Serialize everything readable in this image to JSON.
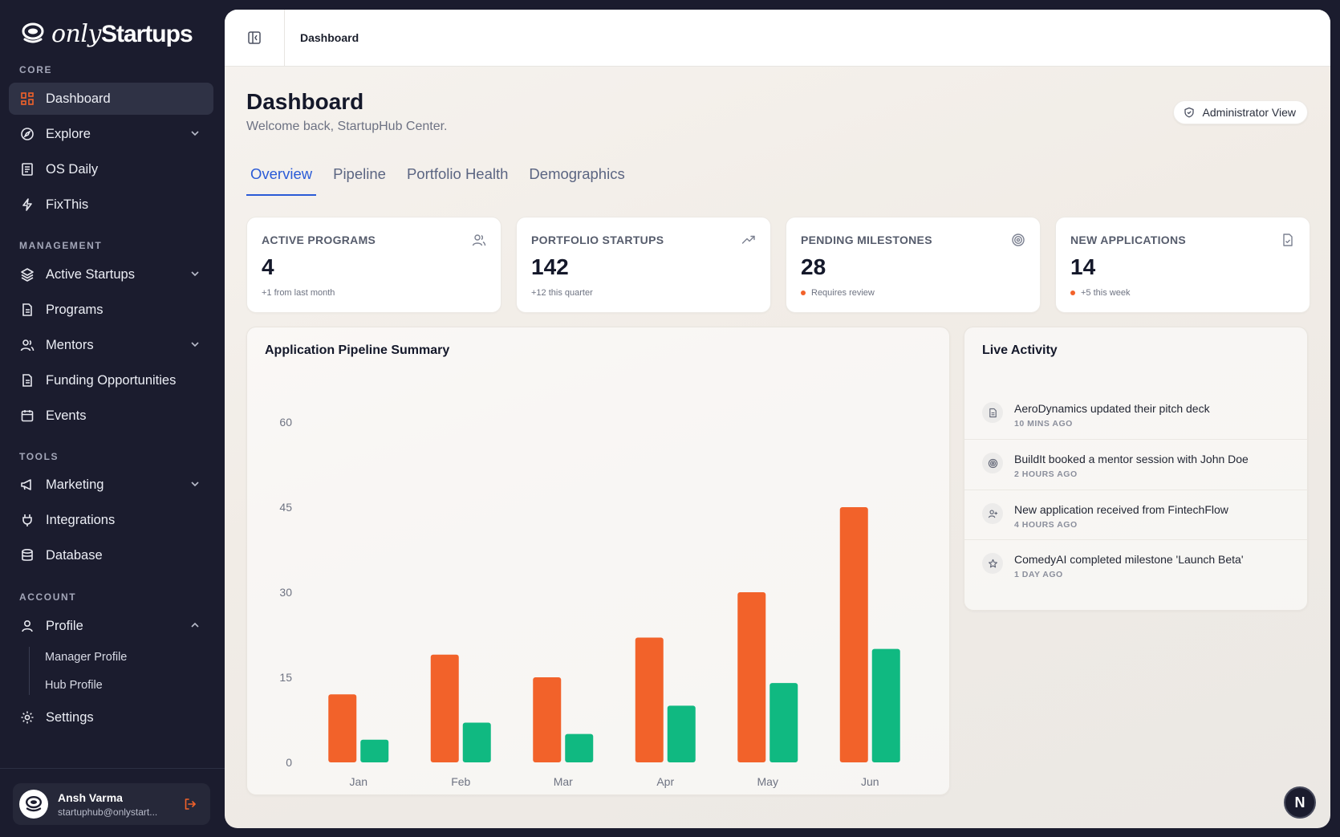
{
  "brand": {
    "name_light": "only",
    "name_bold": "Startups"
  },
  "sidebar": {
    "sections": {
      "core": "CORE",
      "management": "MANAGEMENT",
      "tools": "TOOLS",
      "account": "ACCOUNT"
    },
    "items": {
      "dashboard": "Dashboard",
      "explore": "Explore",
      "os_daily": "OS Daily",
      "fixthis": "FixThis",
      "active_startups": "Active Startups",
      "programs": "Programs",
      "mentors": "Mentors",
      "funding": "Funding Opportunities",
      "events": "Events",
      "marketing": "Marketing",
      "integrations": "Integrations",
      "database": "Database",
      "profile": "Profile",
      "manager_profile": "Manager Profile",
      "hub_profile": "Hub Profile",
      "settings": "Settings"
    },
    "user": {
      "name": "Ansh Varma",
      "email": "startuphub@onlystart..."
    }
  },
  "topbar": {
    "breadcrumb": "Dashboard"
  },
  "header": {
    "title": "Dashboard",
    "subtitle": "Welcome back, StartupHub Center.",
    "admin_button": "Administrator View"
  },
  "tabs": [
    "Overview",
    "Pipeline",
    "Portfolio Health",
    "Demographics"
  ],
  "stats": [
    {
      "label": "ACTIVE PROGRAMS",
      "value": "4",
      "note": "+1 from last month",
      "icon": "users-icon"
    },
    {
      "label": "PORTFOLIO STARTUPS",
      "value": "142",
      "note": "+12 this quarter",
      "icon": "trending-up-icon"
    },
    {
      "label": "PENDING MILESTONES",
      "value": "28",
      "note": "Requires review",
      "icon": "target-icon"
    },
    {
      "label": "NEW APPLICATIONS",
      "value": "14",
      "note": "+5 this week",
      "icon": "file-check-icon"
    }
  ],
  "pipeline_panel": {
    "title": "Application Pipeline Summary"
  },
  "chart_data": {
    "type": "bar",
    "categories": [
      "Jan",
      "Feb",
      "Mar",
      "Apr",
      "May",
      "Jun"
    ],
    "series": [
      {
        "values": [
          12,
          19,
          15,
          22,
          30,
          45
        ],
        "color": "#f2622a"
      },
      {
        "values": [
          4,
          7,
          5,
          10,
          14,
          20
        ],
        "color": "#10b981"
      }
    ],
    "yticks": [
      0,
      15,
      30,
      45,
      60
    ],
    "ylim": [
      0,
      60
    ],
    "grid": false
  },
  "activity_panel": {
    "title": "Live Activity",
    "items": [
      {
        "text": "AeroDynamics updated their pitch deck",
        "time": "10 MINS AGO",
        "icon": "file-icon"
      },
      {
        "text": "BuildIt booked a mentor session with John Doe",
        "time": "2 HOURS AGO",
        "icon": "target-icon"
      },
      {
        "text": "New application received from FintechFlow",
        "time": "4 HOURS AGO",
        "icon": "user-plus-icon"
      },
      {
        "text": "ComedyAI completed milestone 'Launch Beta'",
        "time": "1 DAY AGO",
        "icon": "star-icon"
      }
    ]
  },
  "floating_badge": "N",
  "colors": {
    "accent": "#2a5bd7",
    "brand_orange": "#f2622a",
    "green": "#10b981",
    "sidebar_bg": "#1b1c2e"
  }
}
